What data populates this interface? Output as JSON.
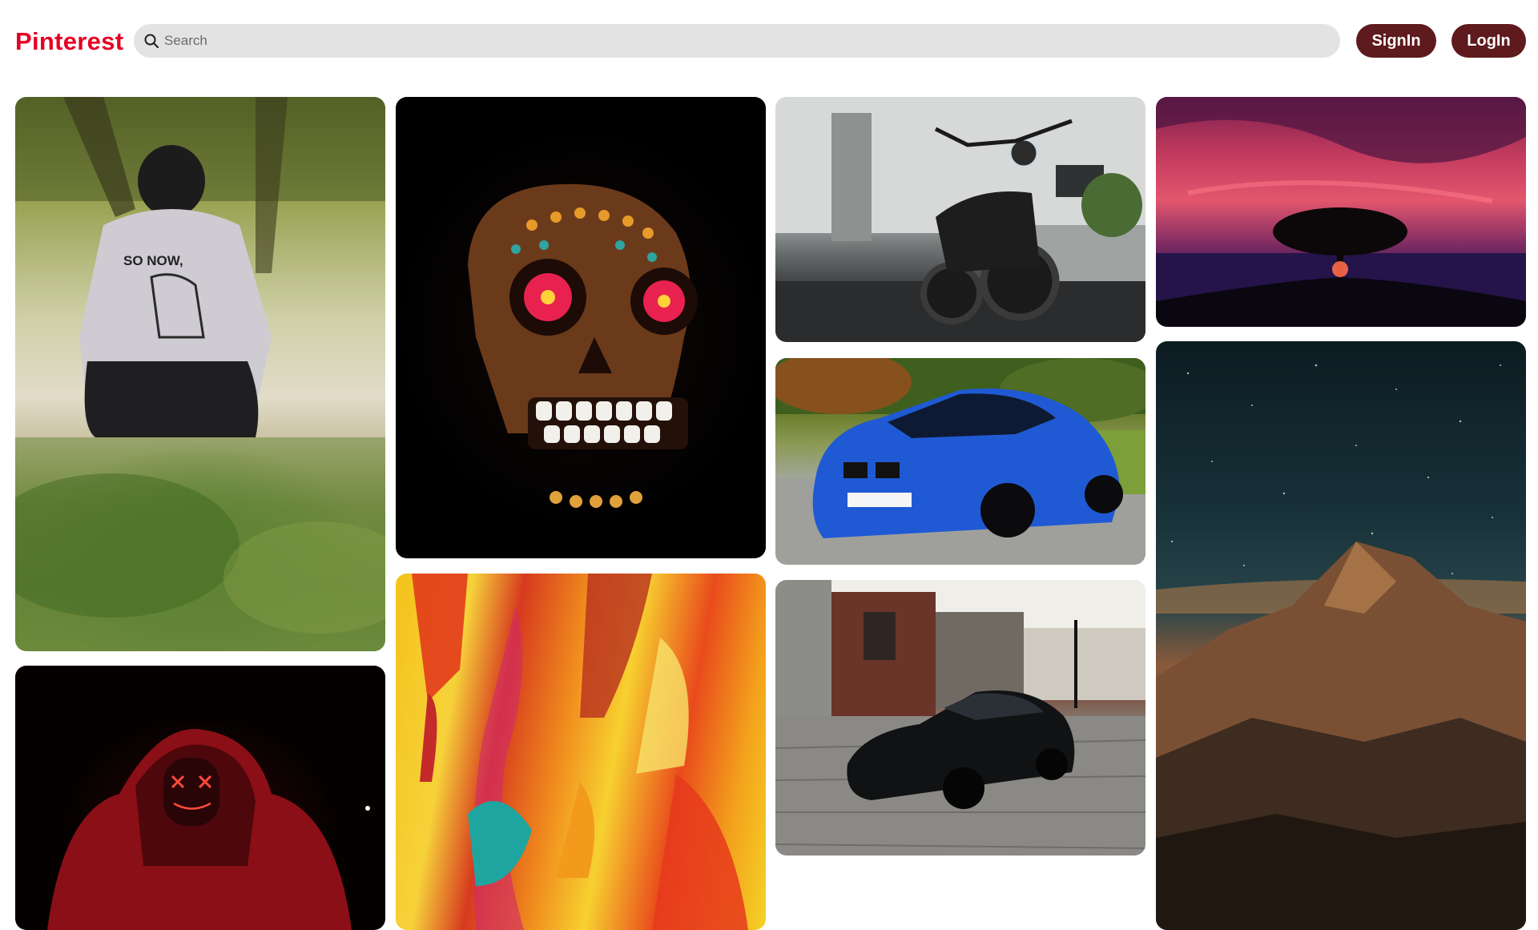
{
  "header": {
    "logo": "Pinterest",
    "search_placeholder": "Search",
    "signin_label": "SignIn",
    "login_label": "LogIn"
  },
  "colors": {
    "brand": "#e60023",
    "button_bg": "#5e1a1d",
    "search_bg": "#e3e3e3"
  },
  "icons": {
    "search": "search-icon"
  }
}
